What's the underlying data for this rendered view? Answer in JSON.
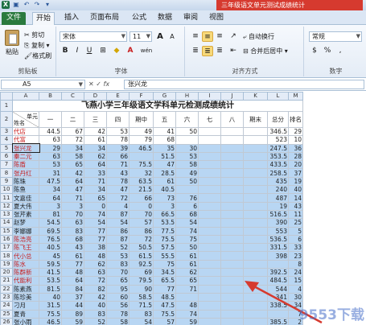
{
  "titlebar": {
    "doc_title": "三年级语文单元测试成绩统计"
  },
  "tabs": [
    "文件",
    "开始",
    "插入",
    "页面布局",
    "公式",
    "数据",
    "审阅",
    "视图"
  ],
  "ribbon": {
    "clipboard": {
      "paste": "粘贴",
      "cut": "剪切",
      "copy": "复制",
      "format_painter": "格式刷",
      "label": "剪贴板"
    },
    "font": {
      "name": "宋体",
      "size": "11",
      "label": "字体",
      "bold": "B",
      "italic": "I",
      "underline": "U",
      "grow": "A",
      "shrink": "A",
      "color_a": "A",
      "phonetic": "wén"
    },
    "alignment": {
      "wrap": "自动换行",
      "merge": "合并后居中",
      "label": "对齐方式"
    },
    "number": {
      "format": "常规",
      "label": "数字",
      "percent": "%",
      "comma": ",",
      "currency": "$"
    }
  },
  "formula_bar": {
    "name": "A5",
    "fx": "fx",
    "value": "张兴龙"
  },
  "sheet": {
    "title": "飞燕小学三年级语文学科单元检测成绩统计",
    "columns": [
      "A",
      "B",
      "C",
      "D",
      "E",
      "F",
      "G",
      "H",
      "I",
      "J",
      "K",
      "L"
    ],
    "header": {
      "unit": "单元",
      "name": "姓名",
      "cols": [
        "一",
        "二",
        "三",
        "四",
        "期中",
        "五",
        "六",
        "七",
        "八",
        "期末",
        "总分",
        "排名"
      ]
    },
    "rows": [
      {
        "n": "3",
        "name": "代店",
        "red": true,
        "v": [
          "44.5",
          "67",
          "42",
          "53",
          "49",
          "41",
          "50",
          "",
          "",
          "",
          "346.5",
          "29"
        ]
      },
      {
        "n": "4",
        "name": "代富",
        "red": true,
        "v": [
          "63",
          "72",
          "61",
          "78",
          "79",
          "68",
          "",
          "",
          "",
          "",
          "523",
          "10"
        ]
      },
      {
        "n": "5",
        "name": "张兴龙",
        "red": true,
        "v": [
          "29",
          "34",
          "34",
          "39",
          "46.5",
          "35",
          "30",
          "",
          "",
          "",
          "247.5",
          "36"
        ]
      },
      {
        "n": "6",
        "name": "秦二元",
        "red": true,
        "v": [
          "63",
          "58",
          "62",
          "66",
          "",
          "51.5",
          "53",
          "",
          "",
          "",
          "353.5",
          "28"
        ]
      },
      {
        "n": "7",
        "name": "陈盾",
        "red": true,
        "v": [
          "53",
          "65",
          "64",
          "71",
          "75.5",
          "47",
          "58",
          "",
          "",
          "",
          "433.5",
          "20"
        ]
      },
      {
        "n": "8",
        "name": "张丹红",
        "red": true,
        "v": [
          "31",
          "42",
          "33",
          "43",
          "32",
          "28.5",
          "49",
          "",
          "",
          "",
          "258.5",
          "37"
        ]
      },
      {
        "n": "9",
        "name": "陈珠",
        "red": false,
        "v": [
          "47.5",
          "64",
          "71",
          "78",
          "63.5",
          "61",
          "50",
          "",
          "",
          "",
          "435",
          "19"
        ]
      },
      {
        "n": "10",
        "name": "陈鱼",
        "red": false,
        "v": [
          "34",
          "47",
          "34",
          "47",
          "21.5",
          "40.5",
          "",
          "",
          "",
          "",
          "240",
          "40"
        ]
      },
      {
        "n": "11",
        "name": "文嘉佳",
        "red": false,
        "v": [
          "64",
          "71",
          "65",
          "72",
          "66",
          "73",
          "76",
          "",
          "",
          "",
          "487",
          "14"
        ]
      },
      {
        "n": "12",
        "name": "夏大伟",
        "red": false,
        "v": [
          "3",
          "3",
          "0",
          "4",
          "0",
          "3",
          "6",
          "",
          "",
          "",
          "19",
          "43"
        ]
      },
      {
        "n": "13",
        "name": "张芹素",
        "red": false,
        "v": [
          "81",
          "70",
          "74",
          "87",
          "70",
          "66.5",
          "68",
          "",
          "",
          "",
          "516.5",
          "11"
        ]
      },
      {
        "n": "14",
        "name": "赵梦",
        "red": false,
        "v": [
          "54.5",
          "63",
          "54",
          "54",
          "57",
          "53.5",
          "54",
          "",
          "",
          "",
          "390",
          "25"
        ]
      },
      {
        "n": "15",
        "name": "李娜娜",
        "red": false,
        "v": [
          "69.5",
          "83",
          "77",
          "86",
          "86",
          "77.5",
          "74",
          "",
          "",
          "",
          "553",
          "5"
        ]
      },
      {
        "n": "16",
        "name": "陈浩亮",
        "red": true,
        "v": [
          "76.5",
          "68",
          "77",
          "87",
          "72",
          "75.5",
          "75",
          "",
          "",
          "",
          "536.5",
          "6"
        ]
      },
      {
        "n": "17",
        "name": "陈飞王",
        "red": true,
        "v": [
          "40.5",
          "43",
          "38",
          "52",
          "50.5",
          "57.5",
          "50",
          "",
          "",
          "",
          "331.5",
          "33"
        ]
      },
      {
        "n": "18",
        "name": "代小总",
        "red": true,
        "v": [
          "45",
          "61",
          "48",
          "53",
          "61.5",
          "55.5",
          "61",
          "",
          "",
          "",
          "398",
          "23"
        ]
      },
      {
        "n": "19",
        "name": "陈水",
        "red": true,
        "v": [
          "59.5",
          "77",
          "62",
          "83",
          "92.5",
          "75",
          "61",
          "",
          "",
          "",
          "",
          "8"
        ]
      },
      {
        "n": "20",
        "name": "陈群新",
        "red": true,
        "v": [
          "41.5",
          "48",
          "63",
          "70",
          "69",
          "34.5",
          "62",
          "",
          "",
          "",
          "392.5",
          "24"
        ]
      },
      {
        "n": "21",
        "name": "代能利",
        "red": true,
        "v": [
          "53.5",
          "64",
          "72",
          "65",
          "79.5",
          "65.5",
          "65",
          "",
          "",
          "",
          "484.5",
          "15"
        ]
      },
      {
        "n": "22",
        "name": "陈素燕",
        "red": false,
        "v": [
          "81.5",
          "84",
          "82",
          "95",
          "90",
          "77",
          "71",
          "",
          "",
          "",
          "544",
          "4"
        ]
      },
      {
        "n": "23",
        "name": "陈珍美",
        "red": false,
        "v": [
          "40",
          "37",
          "42",
          "60",
          "58.5",
          "48.5",
          "",
          "",
          "",
          "",
          "341",
          "30"
        ]
      },
      {
        "n": "24",
        "name": "刁月",
        "red": false,
        "v": [
          "31.5",
          "44",
          "40",
          "56",
          "71.5",
          "47.5",
          "48",
          "",
          "",
          "",
          "338.5",
          "34"
        ]
      },
      {
        "n": "25",
        "name": "夏青",
        "red": false,
        "v": [
          "75.5",
          "89",
          "83",
          "78",
          "83",
          "75.5",
          "74",
          "",
          "",
          "",
          "",
          "7"
        ]
      },
      {
        "n": "26",
        "name": "张小雨",
        "red": false,
        "v": [
          "46.5",
          "59",
          "52",
          "58",
          "54",
          "57",
          "59",
          "",
          "",
          "",
          "385.5",
          "2"
        ]
      }
    ]
  },
  "watermark": "9553下载",
  "colors": {
    "selection": "#b8d6f3",
    "red_text": "#c81e1e",
    "file_tab": "#2a7a3e",
    "title_accent": "#d63a2f"
  }
}
